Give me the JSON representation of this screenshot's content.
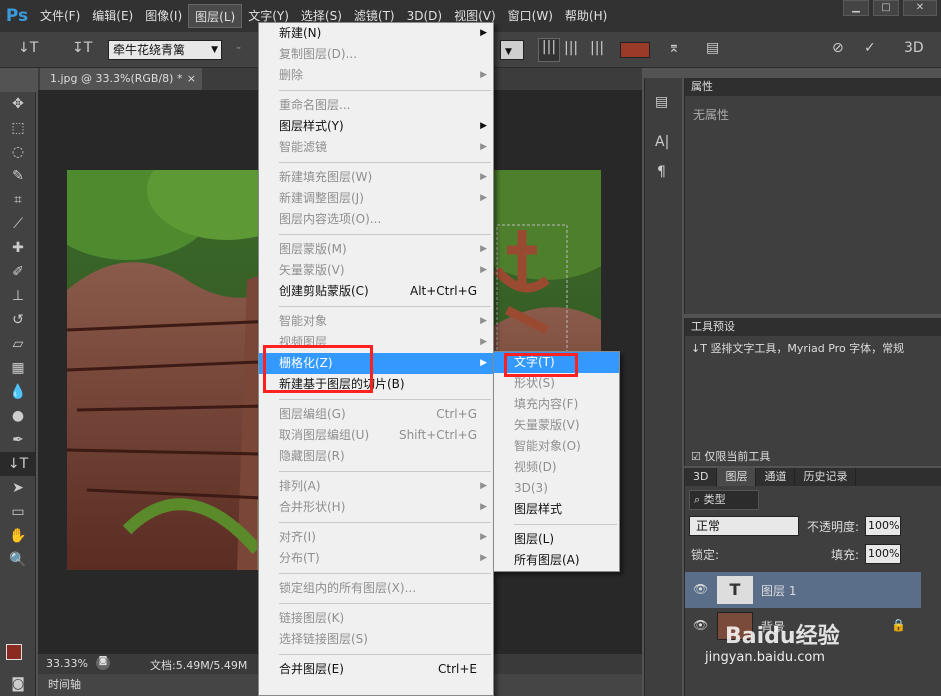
{
  "app": {
    "logo": "Ps"
  },
  "menubar": [
    "文件(F)",
    "编辑(E)",
    "图像(I)",
    "图层(L)",
    "文字(Y)",
    "选择(S)",
    "滤镜(T)",
    "3D(D)",
    "视图(V)",
    "窗口(W)",
    "帮助(H)"
  ],
  "options": {
    "font_family": "牵牛花绕青篱",
    "orient_icon": "text-orientation-icon",
    "color": "#9a3a28"
  },
  "document": {
    "tab_title": "1.jpg @ 33.3%(RGB/8) *",
    "zoom": "33.33%",
    "doc_info": "文档:5.49M/5.49M",
    "timeline": "时间轴"
  },
  "layer_menu": {
    "items": [
      {
        "label": "新建(N)",
        "sub": true
      },
      {
        "label": "复制图层(D)...",
        "dis": true
      },
      {
        "label": "删除",
        "sub": true,
        "dis": true
      },
      {
        "sep": true
      },
      {
        "label": "重命名图层...",
        "dis": true
      },
      {
        "label": "图层样式(Y)",
        "sub": true
      },
      {
        "label": "智能滤镜",
        "sub": true,
        "dis": true
      },
      {
        "sep": true
      },
      {
        "label": "新建填充图层(W)",
        "sub": true,
        "dis": true
      },
      {
        "label": "新建调整图层(J)",
        "sub": true,
        "dis": true
      },
      {
        "label": "图层内容选项(O)...",
        "dis": true
      },
      {
        "sep": true
      },
      {
        "label": "图层蒙版(M)",
        "sub": true,
        "dis": true
      },
      {
        "label": "矢量蒙版(V)",
        "sub": true,
        "dis": true
      },
      {
        "label": "创建剪贴蒙版(C)",
        "shortcut": "Alt+Ctrl+G"
      },
      {
        "sep": true
      },
      {
        "label": "智能对象",
        "sub": true,
        "dis": true
      },
      {
        "label": "视频图层",
        "sub": true,
        "dis": true
      },
      {
        "label": "栅格化(Z)",
        "sub": true,
        "hl": true
      },
      {
        "label": "新建基于图层的切片(B)"
      },
      {
        "sep": true
      },
      {
        "label": "图层编组(G)",
        "shortcut": "Ctrl+G",
        "dis": true
      },
      {
        "label": "取消图层编组(U)",
        "shortcut": "Shift+Ctrl+G",
        "dis": true
      },
      {
        "label": "隐藏图层(R)",
        "dis": true
      },
      {
        "sep": true
      },
      {
        "label": "排列(A)",
        "sub": true,
        "dis": true
      },
      {
        "label": "合并形状(H)",
        "sub": true,
        "dis": true
      },
      {
        "sep": true
      },
      {
        "label": "对齐(I)",
        "sub": true,
        "dis": true
      },
      {
        "label": "分布(T)",
        "sub": true,
        "dis": true
      },
      {
        "sep": true
      },
      {
        "label": "锁定组内的所有图层(X)...",
        "dis": true
      },
      {
        "sep": true
      },
      {
        "label": "链接图层(K)",
        "dis": true
      },
      {
        "label": "选择链接图层(S)",
        "dis": true
      },
      {
        "sep": true
      },
      {
        "label": "合并图层(E)",
        "shortcut": "Ctrl+E"
      }
    ]
  },
  "rasterize_menu": {
    "items": [
      {
        "label": "文字(T)",
        "hl": true
      },
      {
        "label": "形状(S)",
        "dis": true
      },
      {
        "label": "填充内容(F)",
        "dis": true
      },
      {
        "label": "矢量蒙版(V)",
        "dis": true
      },
      {
        "label": "智能对象(O)",
        "dis": true
      },
      {
        "label": "视频(D)",
        "dis": true
      },
      {
        "label": "3D(3)",
        "dis": true
      },
      {
        "label": "图层样式"
      },
      {
        "sep": true
      },
      {
        "label": "图层(L)"
      },
      {
        "label": "所有图层(A)"
      }
    ]
  },
  "properties_panel": {
    "title": "属性",
    "empty": "无属性"
  },
  "tool_presets_panel": {
    "title": "工具预设",
    "preset": "竖排文字工具，Myriad Pro 字体，常规",
    "current_only": "仅限当前工具"
  },
  "layers_panel": {
    "tabs": [
      "3D",
      "图层",
      "通道",
      "历史记录"
    ],
    "filter": "类型",
    "blend": "正常",
    "opacity_label": "不透明度:",
    "opacity": "100%",
    "lock_label": "锁定:",
    "fill_label": "填充:",
    "fill": "100%",
    "layers": [
      {
        "name": "图层 1",
        "type": "text",
        "selected": true
      },
      {
        "name": "背景",
        "type": "image",
        "selected": false
      }
    ]
  },
  "watermark": {
    "brand": "Baidu经验",
    "url": "jingyan.baidu.com"
  }
}
